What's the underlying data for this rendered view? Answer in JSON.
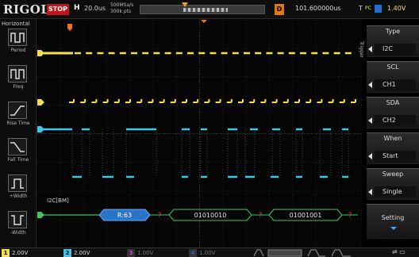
{
  "header": {
    "brand": "RIGOL",
    "run_state": "STOP",
    "horizontal_label": "H",
    "timebase": "20.0us",
    "sample_rate_line1": "500MSa/s",
    "sample_rate_line2": "300k pts",
    "delay_label": "D",
    "delay_value": "101.600000us",
    "trigger_label": "T",
    "trigger_source": "PC",
    "trigger_level": "1.40V"
  },
  "left_panel": {
    "title": "Horizontal",
    "items": [
      {
        "label": "Period"
      },
      {
        "label": "Freq"
      },
      {
        "label": "Rise Time"
      },
      {
        "label": "Fall Time"
      },
      {
        "label": "+Width"
      },
      {
        "label": "-Width"
      }
    ]
  },
  "waveform": {
    "ch1_color": "#f5e04a",
    "ch2_color": "#3ec8e8",
    "bus_color": "#3ec858",
    "bus_label": "I2C[BM]",
    "ch1_marker": "1",
    "ch2_marker": "2",
    "bus_marker": "B1",
    "packets": [
      {
        "text": "R:63",
        "style": "address"
      },
      {
        "text": "?",
        "style": "ack"
      },
      {
        "text": "01010010",
        "style": "data"
      },
      {
        "text": "?",
        "style": "ack"
      },
      {
        "text": "01001001",
        "style": "data"
      },
      {
        "text": "?",
        "style": "ack"
      }
    ]
  },
  "right_menu": {
    "side_tab": "Trigger",
    "items": [
      {
        "title": "Type",
        "value": "I2C"
      },
      {
        "title": "SCL",
        "value": "CH1"
      },
      {
        "title": "SDA",
        "value": "CH2"
      },
      {
        "title": "When",
        "value": "Start"
      },
      {
        "title": "Sweep",
        "value": "Single"
      },
      {
        "title": "Setting",
        "value": ""
      }
    ]
  },
  "footer": {
    "channels": [
      {
        "num": "1",
        "scale": "2.00V",
        "color": "#f5e04a",
        "active": true
      },
      {
        "num": "2",
        "scale": "2.00V",
        "color": "#3ec8e8",
        "active": true
      },
      {
        "num": "3",
        "scale": "1.00V",
        "color": "#d040d0",
        "active": false
      },
      {
        "num": "4",
        "scale": "1.00V",
        "color": "#2060d0",
        "active": false
      }
    ]
  }
}
